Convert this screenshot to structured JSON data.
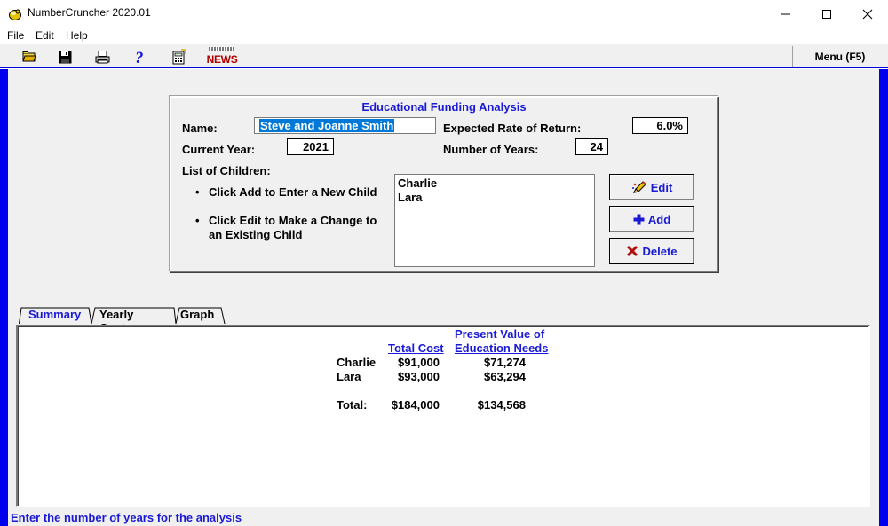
{
  "window": {
    "title": "NumberCruncher 2020.01"
  },
  "menu": {
    "items": [
      "File",
      "Edit",
      "Help"
    ]
  },
  "toolbar": {
    "icons": [
      "open-folder-icon",
      "save-icon",
      "print-icon",
      "help-icon",
      "calculator-icon",
      "news-icon"
    ],
    "news_label": "NEWS",
    "menu_label": "Menu (F5)"
  },
  "form": {
    "title": "Educational Funding Analysis",
    "name_label": "Name:",
    "name_value": "Steve and Joanne Smith",
    "rate_label": "Expected Rate of Return:",
    "rate_value": "6.0%",
    "year_label": "Current Year:",
    "year_value": "2021",
    "years_label": "Number of Years:",
    "years_value": "24",
    "children_label": "List of Children:",
    "instructions": [
      "Click Add to Enter a New Child",
      "Click Edit to Make a Change to",
      "an Existing Child"
    ],
    "children": [
      "Charlie",
      "Lara"
    ],
    "buttons": {
      "edit": "Edit",
      "add": "Add",
      "delete": "Delete"
    }
  },
  "tabs": [
    "Summary",
    "Yearly Cost",
    "Graph"
  ],
  "summary": {
    "header_pv_line1": "Present Value of",
    "header_total": "Total Cost",
    "header_pv_line2": "Education Needs",
    "rows": [
      {
        "name": "Charlie",
        "total": "$91,000",
        "pv": "$71,274"
      },
      {
        "name": "Lara",
        "total": "$93,000",
        "pv": "$63,294"
      }
    ],
    "total_label": "Total:",
    "total_cost": "$184,000",
    "total_pv": "$134,568"
  },
  "status": {
    "text": "Enter the number of years for the analysis"
  }
}
